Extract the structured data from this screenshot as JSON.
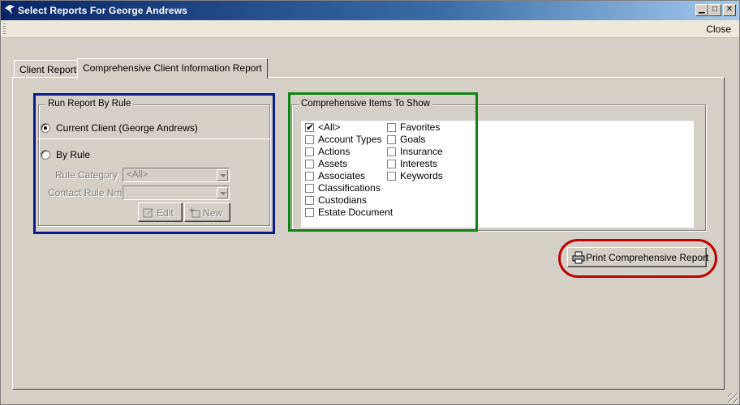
{
  "window": {
    "title": "Select Reports For George Andrews",
    "controls": [
      "minimize",
      "maximize",
      "close"
    ]
  },
  "toolbar": {
    "close_label": "Close"
  },
  "tabs": [
    {
      "label": "Client Reports",
      "active": false
    },
    {
      "label": "Comprehensive Client Information Report",
      "active": true
    }
  ],
  "run_rule": {
    "legend": "Run Report By Rule",
    "option_current": "Current Client (George Andrews)",
    "option_current_selected": true,
    "option_rule": "By Rule",
    "option_rule_selected": false,
    "rule_category_label": "Rule Category",
    "rule_category_value": "<All>",
    "contact_rule_label": "Contact Rule Nm.",
    "contact_rule_value": "",
    "edit_label": "Edit",
    "new_label": "New"
  },
  "items": {
    "legend": "Comprehensive Items To Show",
    "list": [
      {
        "label": "<All>",
        "checked": true
      },
      {
        "label": "Account Types",
        "checked": false
      },
      {
        "label": "Actions",
        "checked": false
      },
      {
        "label": "Assets",
        "checked": false
      },
      {
        "label": "Associates",
        "checked": false
      },
      {
        "label": "Classifications",
        "checked": false
      },
      {
        "label": "Custodians",
        "checked": false
      },
      {
        "label": "Estate Document",
        "checked": false
      },
      {
        "label": "Favorites",
        "checked": false
      },
      {
        "label": "Goals",
        "checked": false
      },
      {
        "label": "Insurance",
        "checked": false
      },
      {
        "label": "Interests",
        "checked": false
      },
      {
        "label": "Keywords",
        "checked": false
      }
    ]
  },
  "print_button_label": "Print Comprehensive Report",
  "colors": {
    "annotation_blue": "#0a1a8c",
    "annotation_green": "#128212",
    "annotation_red": "#c00000"
  }
}
